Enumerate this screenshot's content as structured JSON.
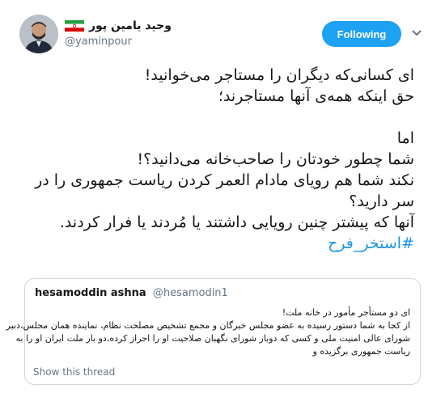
{
  "author": {
    "display_name": "وحید یامین پور",
    "handle": "@yaminpour",
    "flag_icon": "iran-flag-icon",
    "colors": {
      "flag_green": "#239f40",
      "flag_white": "#ffffff",
      "flag_red": "#da0000"
    }
  },
  "follow_button": {
    "label": "Following",
    "color": "#1da1f2"
  },
  "menu_icon": "chevron-down-icon",
  "tweet": {
    "lines": [
      "ای کسانی‌که دیگران را مستاجر می‌خوانید!",
      "حق اینکه همه‌ی آنها مستاجرند؛",
      "",
      "اما",
      "شما چطور خودتان را صاحب‌خانه می‌دانید؟!",
      "نکند شما هم رویای مادام العمر کردن ریاست جمهوری را در",
      "سر دارید؟",
      "آنها که پیشتر چنین رویایی داشتند یا مُردند یا فرار کردند."
    ],
    "hashtag": "#استخر_فرح",
    "hashtag_color": "#1b95e0"
  },
  "quoted_tweet": {
    "name": "hesamoddin ashna",
    "handle": "@hesamodin1",
    "lines": [
      "ای دو مستأجر مأمور در خانه ملت!",
      "از کجا به شما دستور رسیده به عضو مجلس خبرگان و مجمع تشخیص مصلحت نظام،  نماینده همان مجلس،دبیر",
      "شورای عالی امنیت ملی و  کسی که دوبار شورای نگهبان  صلاحیت او را احراز کرده،دو بار ملت ایران او را به",
      "ریاست جمهوری برگزیده و"
    ],
    "show_thread": "Show this thread"
  }
}
